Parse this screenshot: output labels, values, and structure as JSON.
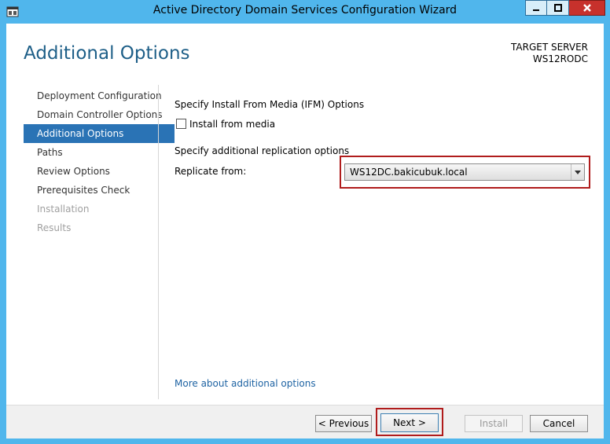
{
  "window": {
    "title": "Active Directory Domain Services Configuration Wizard",
    "controls": {
      "minimize": "minimize-icon",
      "maximize": "maximize-icon",
      "close": "close-icon"
    }
  },
  "header": {
    "page_title": "Additional Options",
    "target_label": "TARGET SERVER",
    "target_server": "WS12RODC"
  },
  "nav": {
    "items": [
      {
        "label": "Deployment Configuration",
        "state": "normal"
      },
      {
        "label": "Domain Controller Options",
        "state": "normal"
      },
      {
        "label": "Additional Options",
        "state": "active"
      },
      {
        "label": "Paths",
        "state": "normal"
      },
      {
        "label": "Review Options",
        "state": "normal"
      },
      {
        "label": "Prerequisites Check",
        "state": "normal"
      },
      {
        "label": "Installation",
        "state": "disabled"
      },
      {
        "label": "Results",
        "state": "disabled"
      }
    ]
  },
  "main": {
    "ifm_heading": "Specify Install From Media (IFM) Options",
    "install_from_media_label": "Install from media",
    "install_from_media_checked": false,
    "replication_heading": "Specify additional replication options",
    "replicate_from_label": "Replicate from:",
    "replicate_from_value": "WS12DC.bakicubuk.local",
    "more_link": "More about additional options"
  },
  "footer": {
    "previous": "< Previous",
    "next": "Next >",
    "install": "Install",
    "cancel": "Cancel"
  },
  "colors": {
    "title_bar": "#50b6ec",
    "heading": "#1e5f88",
    "nav_active": "#2a73b5",
    "link": "#1e63a3",
    "highlight": "#b01c1c"
  }
}
